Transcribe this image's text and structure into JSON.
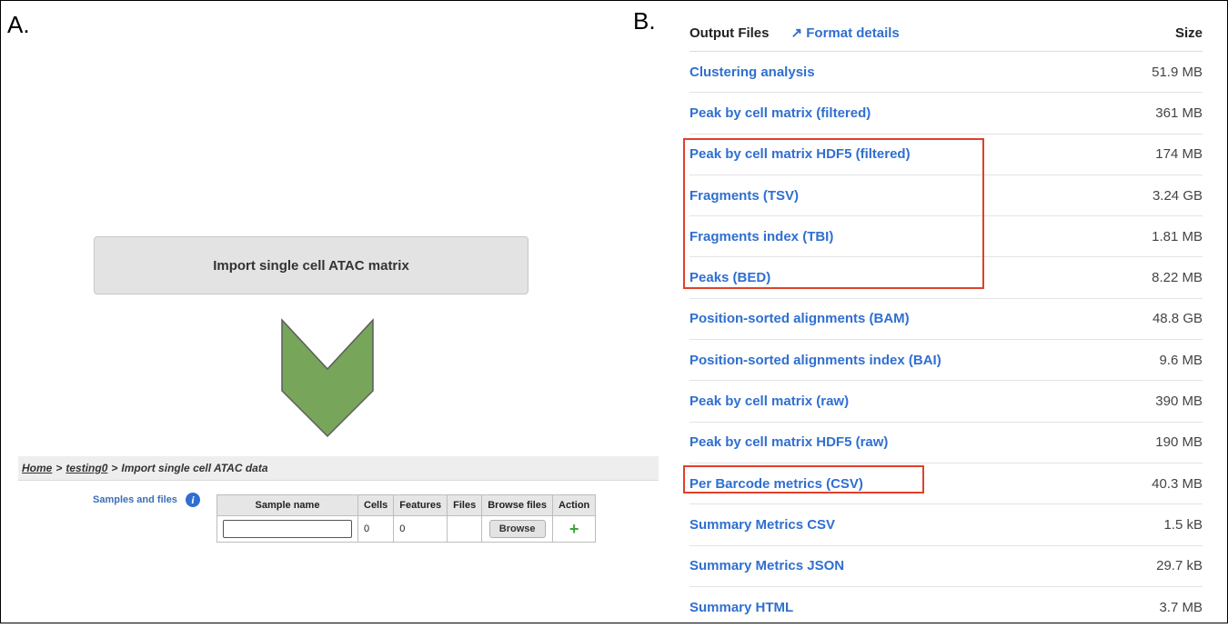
{
  "panel_labels": {
    "a": "A.",
    "b": "B."
  },
  "panel_a": {
    "import_button": "Import single cell ATAC matrix",
    "arrow_color": "#77a55a",
    "breadcrumb": {
      "home": "Home",
      "sep1": ">",
      "project": "testing0",
      "sep2": ">",
      "current": "Import single cell ATAC data"
    },
    "samples_label": "Samples and files",
    "info_icon": "i",
    "table": {
      "headers": [
        "Sample name",
        "Cells",
        "Features",
        "Files",
        "Browse files",
        "Action"
      ],
      "row": {
        "sample_name_value": "",
        "cells": "0",
        "features": "0",
        "files": "",
        "browse_label": "Browse",
        "action_icon": "+"
      }
    }
  },
  "panel_b": {
    "header": {
      "title": "Output Files",
      "format_icon": "↗",
      "format_label": "Format details",
      "size_label": "Size"
    },
    "files": [
      {
        "name": "Clustering analysis",
        "size": "51.9 MB"
      },
      {
        "name": "Peak by cell matrix (filtered)",
        "size": "361 MB"
      },
      {
        "name": "Peak by cell matrix HDF5 (filtered)",
        "size": "174 MB"
      },
      {
        "name": "Fragments (TSV)",
        "size": "3.24 GB"
      },
      {
        "name": "Fragments index (TBI)",
        "size": "1.81 MB"
      },
      {
        "name": "Peaks (BED)",
        "size": "8.22 MB"
      },
      {
        "name": "Position-sorted alignments (BAM)",
        "size": "48.8 GB"
      },
      {
        "name": "Position-sorted alignments index (BAI)",
        "size": "9.6 MB"
      },
      {
        "name": "Peak by cell matrix (raw)",
        "size": "390 MB"
      },
      {
        "name": "Peak by cell matrix HDF5 (raw)",
        "size": "190 MB"
      },
      {
        "name": "Per Barcode metrics (CSV)",
        "size": "40.3 MB"
      },
      {
        "name": "Summary Metrics CSV",
        "size": "1.5 kB"
      },
      {
        "name": "Summary Metrics JSON",
        "size": "29.7 kB"
      },
      {
        "name": "Summary HTML",
        "size": "3.7 MB"
      }
    ],
    "link_color": "#2f6fd1",
    "highlight_color": "#e0402a"
  }
}
